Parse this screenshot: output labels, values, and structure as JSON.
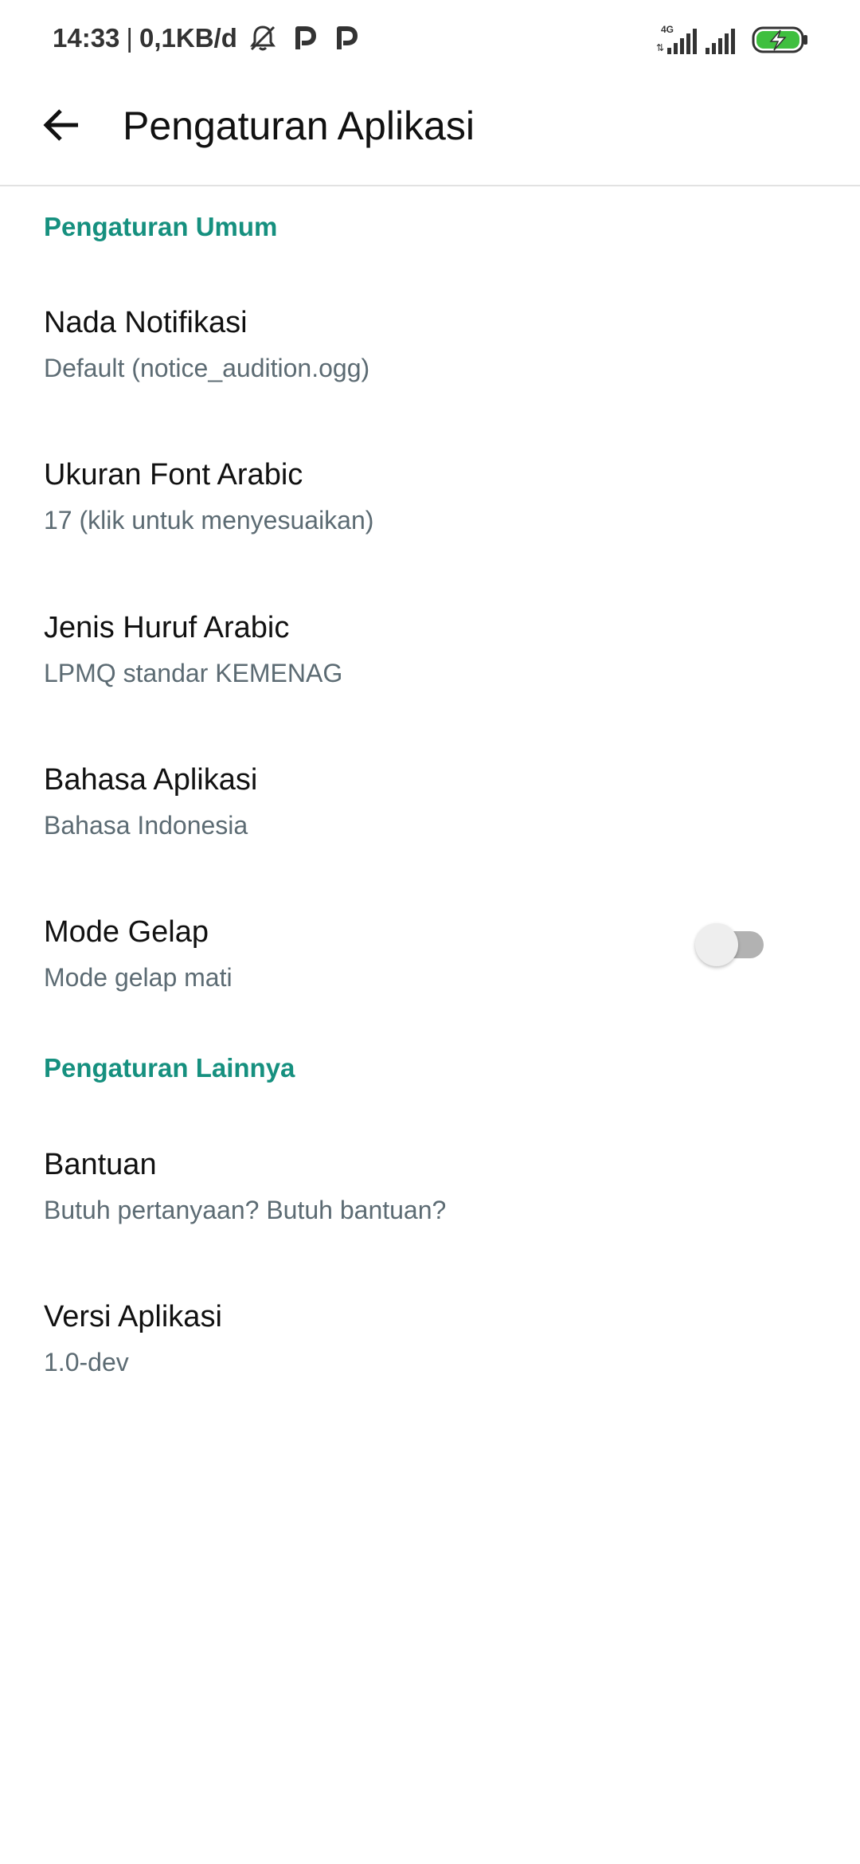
{
  "status_bar": {
    "time": "14:33",
    "separator": "|",
    "network_speed": "0,1KB/d",
    "icons": [
      "bell-muted-icon",
      "p-app-icon",
      "p-app-icon"
    ],
    "network_type": "4G",
    "right_icons": [
      "signal-4g-icon",
      "signal-icon",
      "battery-charging-icon"
    ]
  },
  "app_bar": {
    "back_icon": "arrow-left-icon",
    "title": "Pengaturan Aplikasi"
  },
  "sections": [
    {
      "header": "Pengaturan Umum",
      "items": [
        {
          "title": "Nada Notifikasi",
          "summary": "Default (notice_audition.ogg)"
        },
        {
          "title": "Ukuran Font Arabic",
          "summary": "17 (klik untuk menyesuaikan)"
        },
        {
          "title": "Jenis Huruf Arabic",
          "summary": "LPMQ standar KEMENAG"
        },
        {
          "title": "Bahasa Aplikasi",
          "summary": "Bahasa Indonesia"
        },
        {
          "title": "Mode Gelap",
          "summary": "Mode gelap mati",
          "toggle_on": false
        }
      ]
    },
    {
      "header": "Pengaturan Lainnya",
      "items": [
        {
          "title": "Bantuan",
          "summary": "Butuh pertanyaan? Butuh bantuan?"
        },
        {
          "title": "Versi Aplikasi",
          "summary": "1.0-dev"
        }
      ]
    }
  ],
  "colors": {
    "accent": "#16907f",
    "summary_text": "#5c6b73",
    "battery_green": "#3fbf3f"
  }
}
